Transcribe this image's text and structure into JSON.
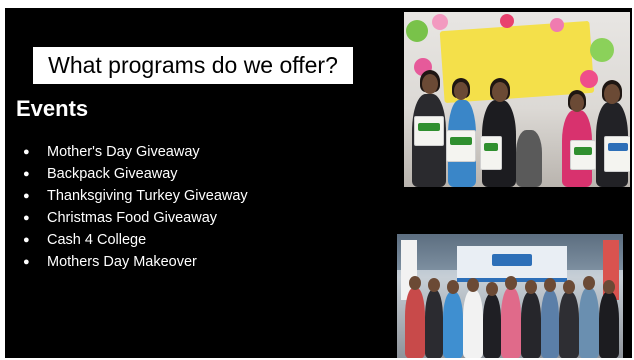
{
  "slide": {
    "title": "What programs do we offer?",
    "section_heading": "Events",
    "bullet_glyph": "●",
    "events": [
      "Mother's Day Giveaway",
      "Backpack Giveaway",
      "Thanksgiving Turkey Giveaway",
      "Christmas Food Giveaway",
      "Cash 4 College",
      "Mothers Day Makeover"
    ]
  },
  "colors": {
    "slide_background": "#000000",
    "title_background": "#ffffff",
    "text": "#ffffff"
  }
}
